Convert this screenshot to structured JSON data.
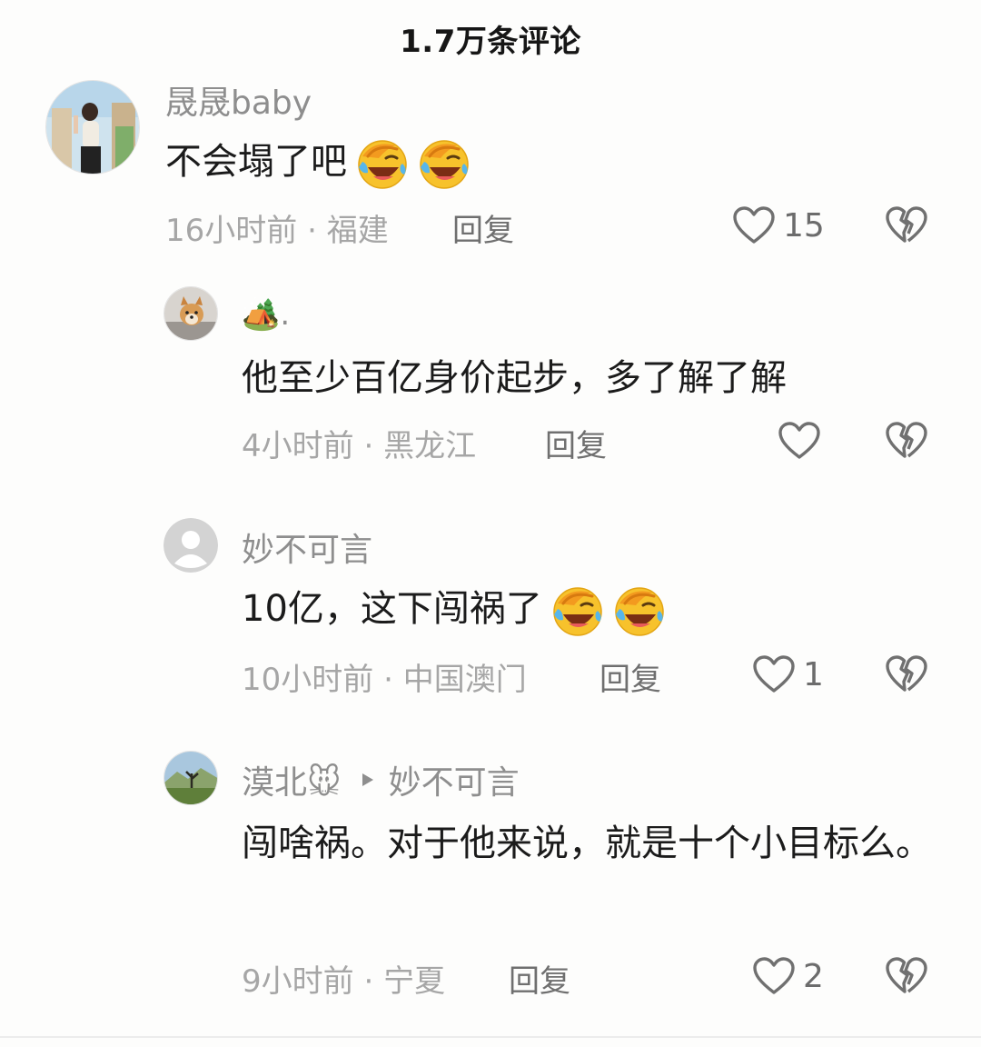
{
  "header": {
    "title": "1.7万条评论"
  },
  "comments": [
    {
      "username": "晟晟baby",
      "text": "不会塌了吧",
      "time": "16小时前",
      "location": "福建",
      "reply_label": "回复",
      "likes": "15",
      "emojis": [
        "laugh-cry-emoji",
        "laugh-cry-emoji"
      ]
    },
    {
      "username": "🏕️.",
      "text": "他至少百亿身价起步，多了解了解",
      "time": "4小时前",
      "location": "黑龙江",
      "reply_label": "回复",
      "likes": ""
    },
    {
      "username": "妙不可言",
      "text": "10亿，这下闯祸了",
      "time": "10小时前",
      "location": "中国澳门",
      "reply_label": "回复",
      "likes": "1",
      "emojis": [
        "laugh-cry-emoji",
        "laugh-cry-emoji"
      ]
    },
    {
      "username": "漠北🐭",
      "reply_to": "妙不可言",
      "text": "闯啥祸。对于他来说，就是十个小目标么。",
      "time": "9小时前",
      "location": "宁夏",
      "reply_label": "回复",
      "likes": "2"
    }
  ],
  "separator": " · ",
  "colors": {
    "meta": "#a6a6a6",
    "text": "#1b1b1b",
    "name": "#8e8e8e",
    "emoji": "#f7c22c"
  }
}
